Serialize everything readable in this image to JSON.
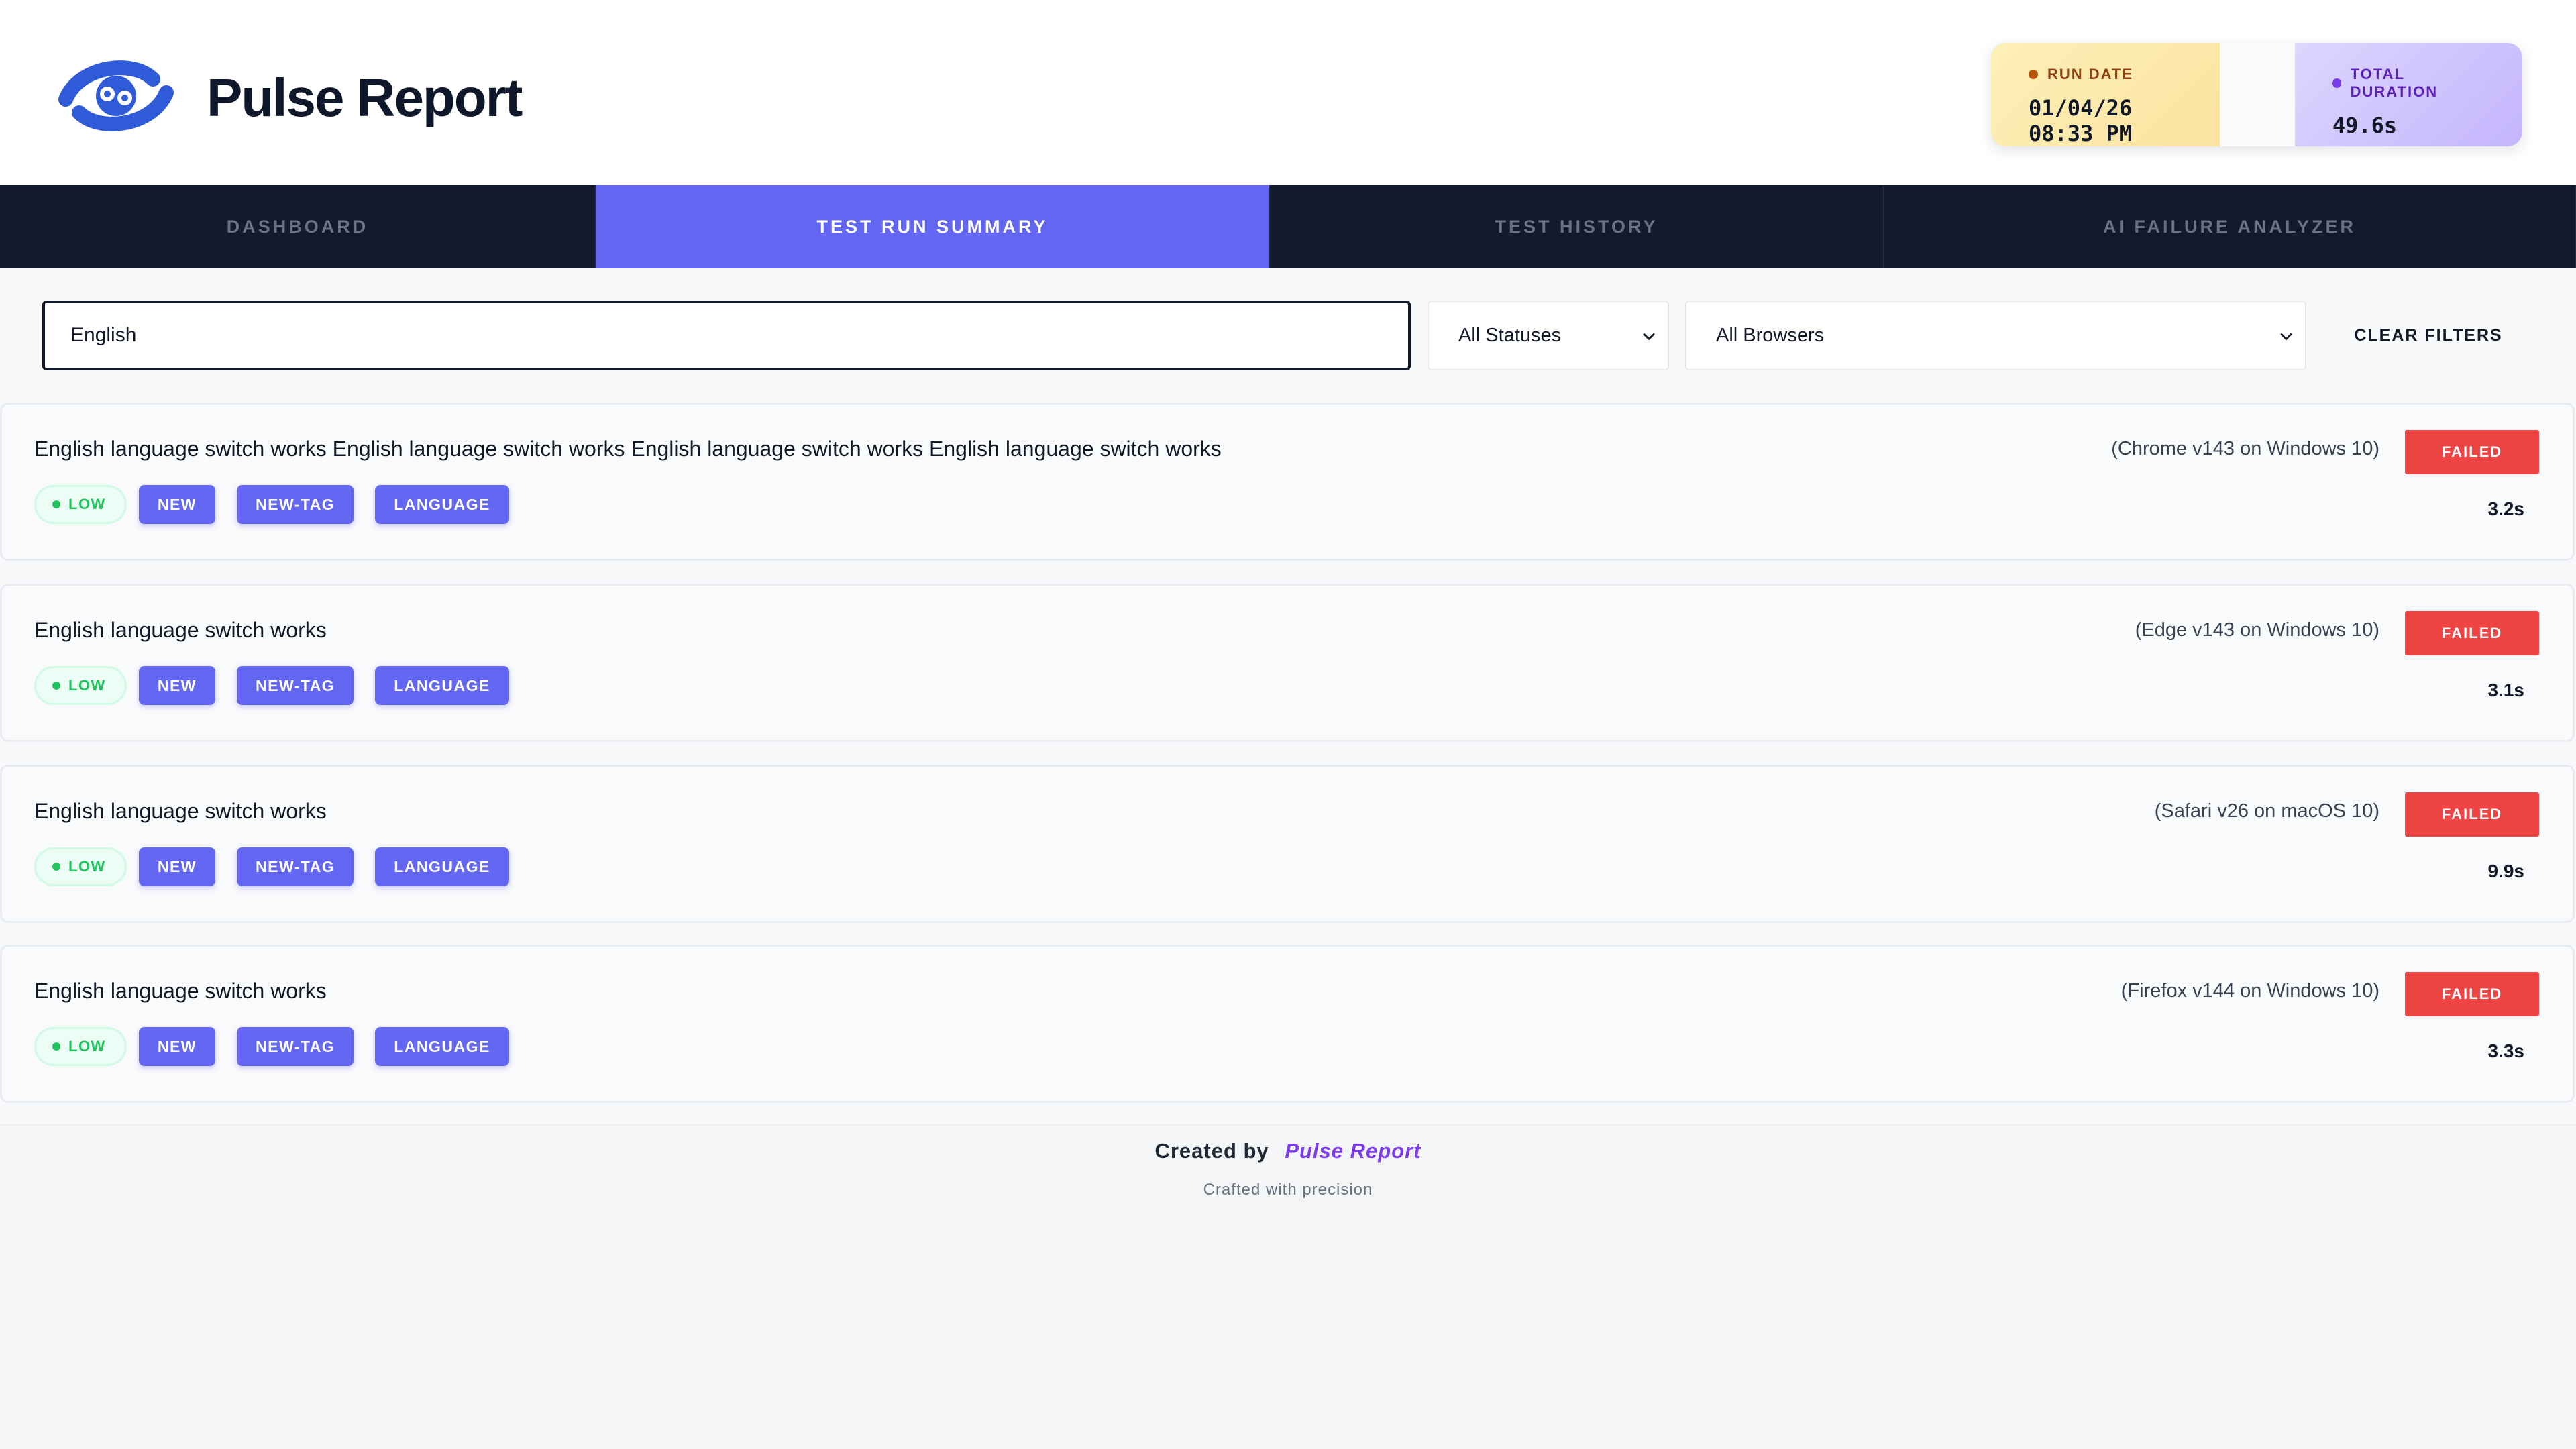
{
  "header": {
    "brand_name": "Pulse Report",
    "run_date_label": "RUN DATE",
    "run_date_value": "01/04/26 08:33 PM",
    "duration_label": "TOTAL DURATION",
    "duration_value": "49.6s"
  },
  "nav": {
    "tabs": [
      {
        "label": "DASHBOARD",
        "active": false
      },
      {
        "label": "TEST RUN SUMMARY",
        "active": true
      },
      {
        "label": "TEST HISTORY",
        "active": false
      },
      {
        "label": "AI FAILURE ANALYZER",
        "active": false
      }
    ]
  },
  "filters": {
    "search_value": "English",
    "status_selected": "All Statuses",
    "browser_selected": "All Browsers",
    "clear_label": "CLEAR FILTERS"
  },
  "results": [
    {
      "title": "English language switch works English language switch works English language switch works English language switch works",
      "browser": "(Chrome v143 on Windows 10)",
      "status": "FAILED",
      "duration": "3.2s",
      "severity": "LOW",
      "tags": [
        "NEW",
        "NEW-TAG",
        "LANGUAGE"
      ]
    },
    {
      "title": "English language switch works",
      "browser": "(Edge v143 on Windows 10)",
      "status": "FAILED",
      "duration": "3.1s",
      "severity": "LOW",
      "tags": [
        "NEW",
        "NEW-TAG",
        "LANGUAGE"
      ]
    },
    {
      "title": "English language switch works",
      "browser": "(Safari v26 on macOS 10)",
      "status": "FAILED",
      "duration": "9.9s",
      "severity": "LOW",
      "tags": [
        "NEW",
        "NEW-TAG",
        "LANGUAGE"
      ]
    },
    {
      "title": "English language switch works",
      "browser": "(Firefox v144 on Windows 10)",
      "status": "FAILED",
      "duration": "3.3s",
      "severity": "LOW",
      "tags": [
        "NEW",
        "NEW-TAG",
        "LANGUAGE"
      ]
    }
  ],
  "footer": {
    "created_by": "Created by",
    "brand": "Pulse Report",
    "tagline": "Crafted with precision"
  },
  "colors": {
    "accent": "#6366f1",
    "nav_bg": "#131a2e",
    "failed": "#ef4444",
    "low": "#22c55e"
  }
}
